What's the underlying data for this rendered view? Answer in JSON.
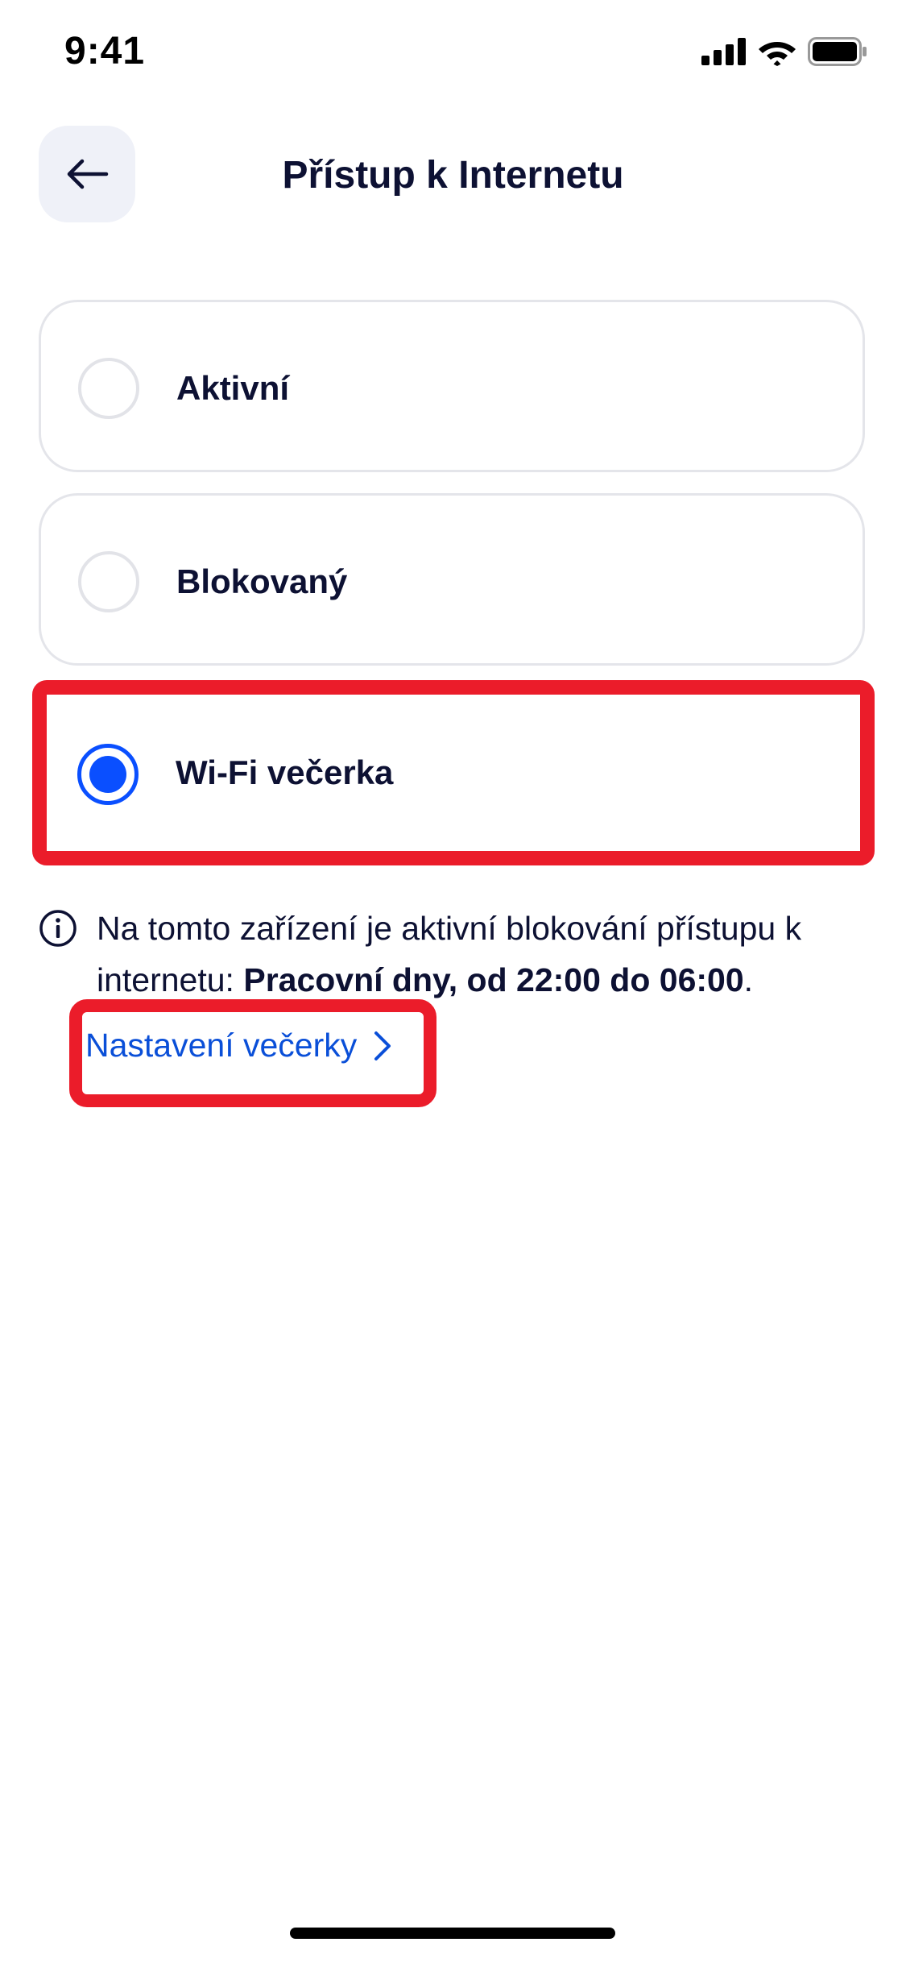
{
  "status_bar": {
    "time": "9:41",
    "icons": [
      "cellular-signal-icon",
      "wifi-icon",
      "battery-icon"
    ]
  },
  "nav": {
    "back_icon": "arrow-left-icon",
    "title": "Přístup k Internetu"
  },
  "options": [
    {
      "label": "Aktivní",
      "selected": false
    },
    {
      "label": "Blokovaný",
      "selected": false
    },
    {
      "label": "Wi-Fi večerka",
      "selected": true
    }
  ],
  "info": {
    "icon": "info-icon",
    "text_prefix": "Na tomto zařízení je aktivní blokování přístupu k internetu: ",
    "text_bold": "Pracovní dny, od 22:00 do 06:00",
    "text_suffix": "."
  },
  "settings_link": {
    "label": "Nastavení večerky",
    "icon": "chevron-right-icon"
  },
  "colors": {
    "accent_blue": "#0a4fff",
    "link_blue": "#0a4fd8",
    "highlight_red": "#eb1c2a",
    "text_dark": "#0d1133",
    "back_button_bg": "#eff1f8"
  }
}
